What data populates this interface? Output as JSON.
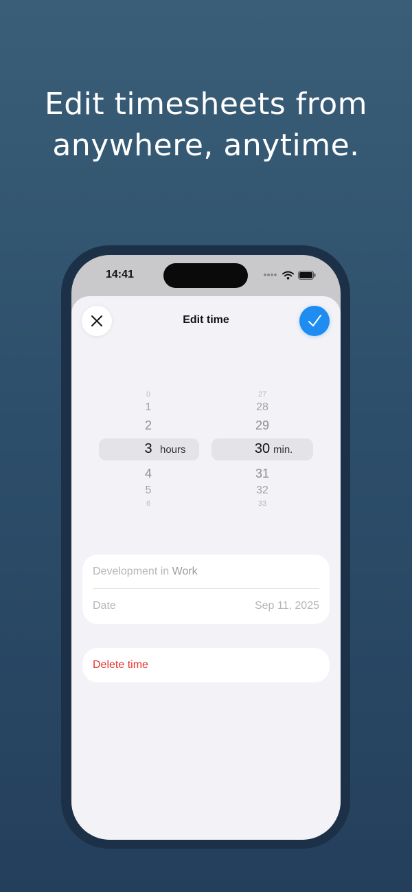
{
  "headline": {
    "line1": "Edit timesheets from",
    "line2": "anywhere, anytime."
  },
  "status_bar": {
    "time": "14:41",
    "icons": [
      "signal-dots-icon",
      "wifi-icon",
      "battery-icon"
    ]
  },
  "sheet": {
    "title": "Edit time",
    "close_icon": "close-icon",
    "done_icon": "checkmark-icon"
  },
  "picker": {
    "hours": {
      "values": [
        "0",
        "1",
        "2",
        "3",
        "4",
        "5",
        "6"
      ],
      "selected": "3",
      "unit": "hours"
    },
    "minutes": {
      "values": [
        "27",
        "28",
        "29",
        "30",
        "31",
        "32",
        "33"
      ],
      "selected": "30",
      "unit": "min."
    }
  },
  "details": {
    "project_prefix": "Development in",
    "project_name": "Work",
    "date_label": "Date",
    "date_value": "Sep 11, 2025"
  },
  "delete_label": "Delete time",
  "colors": {
    "accent": "#1e8cf0",
    "destructive": "#e5322d",
    "background_top": "#3a5e78",
    "background_bottom": "#243f5c"
  }
}
